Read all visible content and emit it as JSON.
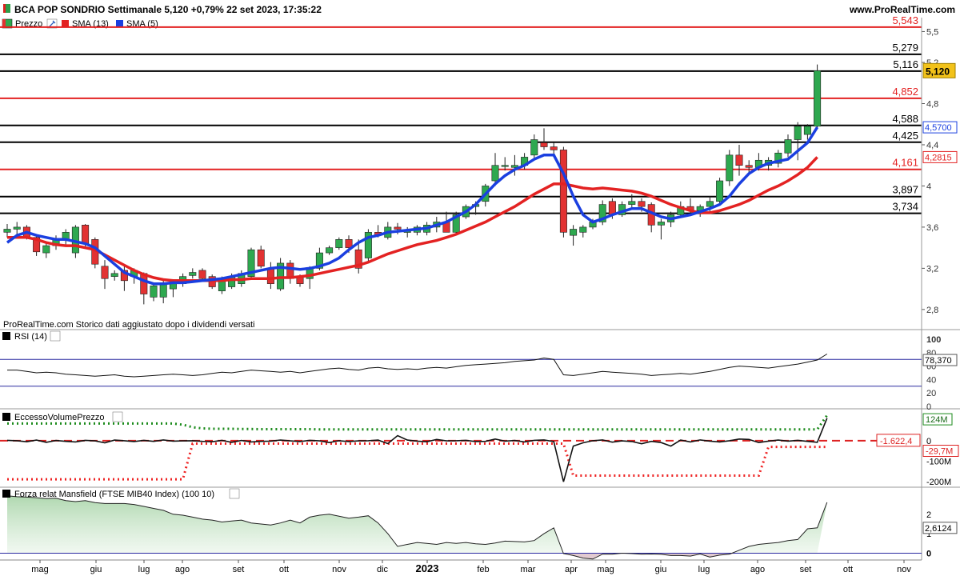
{
  "header": {
    "title": "BCA POP SONDRIO Settimanale 5,120 +0,79% 22 set 2023, 17:35:22",
    "site": "www.ProRealTime.com"
  },
  "legend": {
    "price": "Prezzo",
    "sma13": "SMA (13)",
    "sma5": "SMA (5)"
  },
  "footnote": "ProRealTime.com  Storico dati aggiustato dopo i dividendi versati",
  "colors": {
    "up": "#2ea84f",
    "down": "#e23232",
    "sma13": "#e32222",
    "sma5": "#1a3fe0",
    "hline_red": "#e32222",
    "hline_black": "#000000"
  },
  "chart_data": [
    {
      "type": "candlestick",
      "panel": "price",
      "ylim": [
        2.62,
        5.62
      ],
      "y_ticks": [
        "5,5",
        "5,2",
        "4,8",
        "4,4",
        "4",
        "3,6",
        "3,2",
        "2,8"
      ],
      "x_ticks": [
        "mag",
        "giu",
        "lug",
        "ago",
        "set",
        "ott",
        "nov",
        "dic",
        "2023",
        "feb",
        "mar",
        "apr",
        "mag",
        "giu",
        "lug",
        "ago",
        "set",
        "ott",
        "nov"
      ],
      "hlines": [
        {
          "value": 5.543,
          "label": "5,543",
          "color": "red"
        },
        {
          "value": 5.279,
          "label": "5,279",
          "color": "black"
        },
        {
          "value": 5.116,
          "label": "5,116",
          "color": "black"
        },
        {
          "value": 4.852,
          "label": "4,852",
          "color": "red"
        },
        {
          "value": 4.588,
          "label": "4,588",
          "color": "black"
        },
        {
          "value": 4.425,
          "label": "4,425",
          "color": "black"
        },
        {
          "value": 4.161,
          "label": "4,161",
          "color": "red"
        },
        {
          "value": 3.897,
          "label": "3,897",
          "color": "black"
        },
        {
          "value": 3.734,
          "label": "3,734",
          "color": "black"
        }
      ],
      "last_price": "5,120",
      "sma5_last": "4,5700",
      "sma13_last": "4,2815",
      "candles": [
        [
          3.55,
          3.63,
          3.5,
          3.58
        ],
        [
          3.58,
          3.65,
          3.53,
          3.6
        ],
        [
          3.6,
          3.62,
          3.48,
          3.5
        ],
        [
          3.5,
          3.52,
          3.32,
          3.36
        ],
        [
          3.35,
          3.45,
          3.3,
          3.42
        ],
        [
          3.42,
          3.52,
          3.38,
          3.48
        ],
        [
          3.48,
          3.58,
          3.42,
          3.55
        ],
        [
          3.35,
          3.62,
          3.3,
          3.6
        ],
        [
          3.62,
          3.63,
          3.4,
          3.44
        ],
        [
          3.48,
          3.5,
          3.2,
          3.24
        ],
        [
          3.22,
          3.28,
          3.0,
          3.1
        ],
        [
          3.12,
          3.18,
          3.08,
          3.15
        ],
        [
          3.18,
          3.22,
          2.98,
          3.08
        ],
        [
          3.12,
          3.2,
          3.05,
          3.18
        ],
        [
          3.15,
          3.16,
          2.85,
          2.95
        ],
        [
          2.92,
          3.05,
          2.88,
          3.03
        ],
        [
          2.92,
          3.1,
          2.86,
          3.06
        ],
        [
          3.0,
          3.08,
          2.92,
          3.05
        ],
        [
          3.05,
          3.15,
          3.02,
          3.12
        ],
        [
          3.13,
          3.2,
          3.1,
          3.16
        ],
        [
          3.18,
          3.2,
          3.08,
          3.1
        ],
        [
          3.12,
          3.14,
          3.0,
          3.02
        ],
        [
          2.98,
          3.12,
          2.95,
          3.1
        ],
        [
          3.02,
          3.15,
          3.0,
          3.12
        ],
        [
          3.05,
          3.18,
          3.02,
          3.15
        ],
        [
          3.12,
          3.4,
          3.1,
          3.38
        ],
        [
          3.38,
          3.42,
          3.2,
          3.22
        ],
        [
          3.2,
          3.26,
          3.0,
          3.05
        ],
        [
          3.0,
          3.3,
          2.98,
          3.25
        ],
        [
          3.25,
          3.28,
          3.05,
          3.1
        ],
        [
          3.12,
          3.14,
          3.02,
          3.05
        ],
        [
          3.1,
          3.22,
          3.0,
          3.2
        ],
        [
          3.2,
          3.4,
          3.18,
          3.35
        ],
        [
          3.35,
          3.42,
          3.33,
          3.4
        ],
        [
          3.4,
          3.5,
          3.38,
          3.48
        ],
        [
          3.48,
          3.52,
          3.35,
          3.4
        ],
        [
          3.38,
          3.48,
          3.15,
          3.2
        ],
        [
          3.3,
          3.58,
          3.25,
          3.55
        ],
        [
          3.55,
          3.62,
          3.5,
          3.52
        ],
        [
          3.5,
          3.65,
          3.48,
          3.6
        ],
        [
          3.6,
          3.64,
          3.53,
          3.58
        ],
        [
          3.55,
          3.6,
          3.5,
          3.56
        ],
        [
          3.55,
          3.62,
          3.52,
          3.6
        ],
        [
          3.55,
          3.65,
          3.52,
          3.62
        ],
        [
          3.6,
          3.7,
          3.55,
          3.65
        ],
        [
          3.65,
          3.75,
          3.6,
          3.55
        ],
        [
          3.55,
          3.75,
          3.53,
          3.72
        ],
        [
          3.7,
          3.82,
          3.68,
          3.8
        ],
        [
          3.8,
          3.85,
          3.72,
          3.82
        ],
        [
          3.85,
          4.02,
          3.8,
          4.0
        ],
        [
          4.05,
          4.32,
          4.0,
          4.2
        ],
        [
          4.2,
          4.28,
          4.15,
          4.2
        ],
        [
          4.18,
          4.3,
          4.1,
          4.2
        ],
        [
          4.2,
          4.32,
          4.16,
          4.28
        ],
        [
          4.3,
          4.5,
          4.25,
          4.45
        ],
        [
          4.42,
          4.56,
          4.35,
          4.38
        ],
        [
          4.38,
          4.42,
          4.3,
          4.35
        ],
        [
          4.35,
          4.38,
          3.5,
          3.55
        ],
        [
          3.52,
          3.62,
          3.42,
          3.58
        ],
        [
          3.55,
          3.62,
          3.5,
          3.6
        ],
        [
          3.6,
          3.68,
          3.58,
          3.65
        ],
        [
          3.65,
          3.86,
          3.62,
          3.82
        ],
        [
          3.85,
          3.88,
          3.68,
          3.72
        ],
        [
          3.72,
          3.85,
          3.7,
          3.82
        ],
        [
          3.82,
          3.92,
          3.78,
          3.85
        ],
        [
          3.85,
          3.88,
          3.75,
          3.8
        ],
        [
          3.82,
          3.84,
          3.55,
          3.62
        ],
        [
          3.62,
          3.68,
          3.48,
          3.65
        ],
        [
          3.65,
          3.75,
          3.6,
          3.72
        ],
        [
          3.72,
          3.85,
          3.7,
          3.8
        ],
        [
          3.8,
          3.88,
          3.72,
          3.76
        ],
        [
          3.76,
          3.82,
          3.7,
          3.8
        ],
        [
          3.8,
          3.9,
          3.75,
          3.85
        ],
        [
          3.85,
          4.08,
          3.82,
          4.05
        ],
        [
          4.05,
          4.35,
          4.0,
          4.3
        ],
        [
          4.3,
          4.4,
          4.1,
          4.2
        ],
        [
          4.2,
          4.25,
          4.12,
          4.18
        ],
        [
          4.18,
          4.32,
          4.15,
          4.25
        ],
        [
          4.2,
          4.28,
          4.15,
          4.25
        ],
        [
          4.22,
          4.35,
          4.18,
          4.32
        ],
        [
          4.32,
          4.5,
          4.28,
          4.45
        ],
        [
          4.45,
          4.62,
          4.25,
          4.58
        ],
        [
          4.5,
          4.6,
          4.45,
          4.58
        ],
        [
          4.58,
          5.18,
          4.55,
          5.12
        ]
      ],
      "sma13": [
        3.5,
        3.5,
        3.5,
        3.48,
        3.45,
        3.43,
        3.42,
        3.42,
        3.4,
        3.38,
        3.33,
        3.28,
        3.23,
        3.18,
        3.14,
        3.11,
        3.09,
        3.08,
        3.08,
        3.08,
        3.08,
        3.08,
        3.08,
        3.09,
        3.09,
        3.1,
        3.1,
        3.1,
        3.11,
        3.11,
        3.12,
        3.13,
        3.15,
        3.17,
        3.19,
        3.21,
        3.23,
        3.26,
        3.3,
        3.34,
        3.37,
        3.4,
        3.43,
        3.45,
        3.47,
        3.5,
        3.53,
        3.57,
        3.61,
        3.65,
        3.7,
        3.75,
        3.8,
        3.86,
        3.92,
        3.97,
        4.02,
        4.02,
        4.0,
        3.98,
        3.97,
        3.98,
        3.97,
        3.96,
        3.95,
        3.93,
        3.9,
        3.86,
        3.82,
        3.79,
        3.76,
        3.74,
        3.74,
        3.76,
        3.79,
        3.82,
        3.86,
        3.91,
        3.96,
        4.0,
        4.05,
        4.11,
        4.18,
        4.28
      ],
      "sma5": [
        3.45,
        3.52,
        3.55,
        3.52,
        3.5,
        3.48,
        3.48,
        3.46,
        3.44,
        3.4,
        3.32,
        3.24,
        3.16,
        3.12,
        3.08,
        3.05,
        3.05,
        3.06,
        3.06,
        3.07,
        3.08,
        3.09,
        3.1,
        3.12,
        3.14,
        3.16,
        3.18,
        3.2,
        3.21,
        3.2,
        3.19,
        3.2,
        3.22,
        3.25,
        3.3,
        3.38,
        3.45,
        3.5,
        3.52,
        3.55,
        3.56,
        3.57,
        3.58,
        3.59,
        3.62,
        3.65,
        3.7,
        3.75,
        3.82,
        3.92,
        4.02,
        4.1,
        4.16,
        4.2,
        4.26,
        4.3,
        4.3,
        4.12,
        3.9,
        3.72,
        3.65,
        3.68,
        3.72,
        3.75,
        3.78,
        3.78,
        3.74,
        3.7,
        3.68,
        3.7,
        3.72,
        3.75,
        3.78,
        3.82,
        3.9,
        4.02,
        4.12,
        4.18,
        4.22,
        4.24,
        4.26,
        4.34,
        4.42,
        4.57
      ]
    },
    {
      "type": "line",
      "panel": "rsi",
      "title": "RSI (14)",
      "y_ticks": [
        "100",
        "80",
        "60",
        "40",
        "20",
        "0"
      ],
      "ylim": [
        0,
        100
      ],
      "levels": [
        70,
        30
      ],
      "last": "78,370",
      "values": [
        54,
        54,
        52,
        50,
        51,
        50,
        48,
        47,
        46,
        45,
        46,
        47,
        45,
        44,
        45,
        46,
        47,
        48,
        47,
        46,
        47,
        49,
        51,
        50,
        52,
        54,
        53,
        52,
        51,
        52,
        50,
        52,
        54,
        56,
        57,
        55,
        54,
        57,
        58,
        56,
        55,
        56,
        55,
        57,
        58,
        57,
        59,
        61,
        62,
        63,
        64,
        65,
        67,
        68,
        69,
        72,
        70,
        47,
        46,
        48,
        50,
        52,
        51,
        50,
        49,
        48,
        46,
        47,
        48,
        49,
        48,
        50,
        52,
        55,
        58,
        60,
        59,
        58,
        57,
        59,
        61,
        63,
        66,
        69,
        78
      ]
    },
    {
      "type": "line",
      "panel": "volume_excess",
      "title": "EccessoVolumePrezzo",
      "y_ticks": [
        "124M",
        "0",
        "-100M",
        "-200M"
      ],
      "ylim": [
        -215,
        140
      ],
      "last_upper": "124M",
      "last_lower": "-29,7M",
      "ref_value": "-1.622,4",
      "values": [
        2,
        0,
        -5,
        3,
        -8,
        1,
        -3,
        -6,
        2,
        -1,
        -10,
        3,
        0,
        -4,
        2,
        -3,
        4,
        -2,
        -1,
        0,
        -3,
        -5,
        2,
        -8,
        1,
        -6,
        -3,
        -2,
        3,
        -1,
        -4,
        2,
        -1,
        -9,
        0,
        -4,
        -1,
        0,
        3,
        -14,
        25,
        3,
        -2,
        -5,
        6,
        -1,
        0,
        2,
        -4,
        -3,
        8,
        -2,
        1,
        -6,
        2,
        4,
        -4,
        -200,
        -26,
        -10,
        0,
        4,
        -7,
        -1,
        -4,
        -15,
        -3,
        -9,
        -26,
        3,
        -6,
        4,
        -2,
        -6,
        0,
        8,
        6,
        -9,
        -2,
        3,
        -2,
        2,
        -3,
        -8,
        110
      ],
      "upper_band": [
        84,
        84,
        84,
        84,
        84,
        84,
        84,
        84,
        84,
        84,
        84,
        84,
        84,
        84,
        84,
        84,
        84,
        84,
        78,
        66,
        60,
        58,
        58,
        58,
        57,
        57,
        56,
        56,
        56,
        56,
        56,
        56,
        55,
        55,
        55,
        55,
        55,
        55,
        55,
        55,
        55,
        55,
        55,
        55,
        55,
        55,
        55,
        55,
        55,
        55,
        55,
        55,
        55,
        55,
        55,
        55,
        55,
        55,
        55,
        55,
        55,
        55,
        55,
        55,
        55,
        55,
        55,
        55,
        55,
        55,
        55,
        55,
        55,
        55,
        55,
        55,
        55,
        55,
        55,
        55,
        55,
        55,
        55,
        55,
        124
      ],
      "lower_band": [
        -188,
        -188,
        -188,
        -188,
        -188,
        -188,
        -188,
        -188,
        -188,
        -188,
        -188,
        -188,
        -188,
        -188,
        -188,
        -188,
        -188,
        -188,
        -188,
        -14,
        -14,
        -14,
        -14,
        -14,
        -14,
        -14,
        -14,
        -14,
        -14,
        -14,
        -14,
        -14,
        -14,
        -14,
        -14,
        -14,
        -14,
        -14,
        -14,
        -14,
        -14,
        -14,
        -14,
        -14,
        -14,
        -14,
        -14,
        -14,
        -14,
        -14,
        -14,
        -14,
        -14,
        -14,
        -14,
        -14,
        -14,
        -14,
        -170,
        -170,
        -170,
        -170,
        -170,
        -170,
        -170,
        -170,
        -170,
        -170,
        -170,
        -170,
        -170,
        -170,
        -170,
        -170,
        -170,
        -170,
        -170,
        -170,
        -30,
        -30,
        -30,
        -30,
        -30,
        -30,
        -30
      ]
    },
    {
      "type": "area",
      "panel": "mansfield",
      "title": "Forza relat Mansfield (FTSE MIB40 Index) (100 10)",
      "y_ticks": [
        "2",
        "1",
        "0"
      ],
      "ylim": [
        -0.35,
        3.1
      ],
      "last": "2,6124",
      "values": [
        2.95,
        2.9,
        2.88,
        2.85,
        2.8,
        2.82,
        2.7,
        2.65,
        2.7,
        2.6,
        2.55,
        2.55,
        2.55,
        2.5,
        2.4,
        2.3,
        2.2,
        2.0,
        1.95,
        1.85,
        1.75,
        1.7,
        1.6,
        1.65,
        1.7,
        1.55,
        1.5,
        1.45,
        1.55,
        1.7,
        1.55,
        1.85,
        1.95,
        2.0,
        1.9,
        1.8,
        1.85,
        1.92,
        1.55,
        1.0,
        0.35,
        0.45,
        0.55,
        0.5,
        0.45,
        0.55,
        0.5,
        0.55,
        0.48,
        0.45,
        0.52,
        0.62,
        0.6,
        0.58,
        0.65,
        1.0,
        1.3,
        -0.02,
        -0.12,
        -0.25,
        -0.3,
        -0.05,
        -0.05,
        0.0,
        -0.02,
        -0.05,
        -0.04,
        -0.06,
        -0.12,
        -0.12,
        -0.15,
        -0.04,
        -0.2,
        -0.1,
        -0.05,
        0.15,
        0.35,
        0.45,
        0.5,
        0.55,
        0.65,
        0.7,
        1.25,
        1.3,
        2.61
      ]
    }
  ]
}
